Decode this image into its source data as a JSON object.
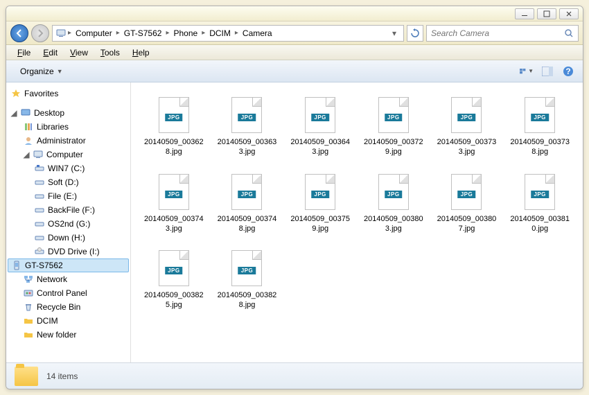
{
  "titlebar": {
    "min": "–",
    "max": "☐",
    "close": "✕"
  },
  "breadcrumb": {
    "items": [
      "Computer",
      "GT-S7562",
      "Phone",
      "DCIM",
      "Camera"
    ]
  },
  "search": {
    "placeholder": "Search Camera"
  },
  "menu": {
    "file": "File",
    "edit": "Edit",
    "view": "View",
    "tools": "Tools",
    "help": "Help"
  },
  "toolbar": {
    "organize": "Organize"
  },
  "sidebar": {
    "favorites": "Favorites",
    "desktop": "Desktop",
    "libraries": "Libraries",
    "administrator": "Administrator",
    "computer": "Computer",
    "drives": [
      "WIN7 (C:)",
      "Soft (D:)",
      "File (E:)",
      "BackFile (F:)",
      "OS2nd (G:)",
      "Down (H:)",
      "DVD Drive (I:)",
      "GT-S7562"
    ],
    "network": "Network",
    "controlpanel": "Control Panel",
    "recyclebin": "Recycle Bin",
    "dcim": "DCIM",
    "newfolder": "New folder"
  },
  "files": [
    "20140509_003628.jpg",
    "20140509_003633.jpg",
    "20140509_003643.jpg",
    "20140509_003729.jpg",
    "20140509_003733.jpg",
    "20140509_003738.jpg",
    "20140509_003743.jpg",
    "20140509_003748.jpg",
    "20140509_003759.jpg",
    "20140509_003803.jpg",
    "20140509_003807.jpg",
    "20140509_003810.jpg",
    "20140509_003825.jpg",
    "20140509_003828.jpg"
  ],
  "status": {
    "count": "14 items"
  },
  "jpg_badge": "JPG"
}
